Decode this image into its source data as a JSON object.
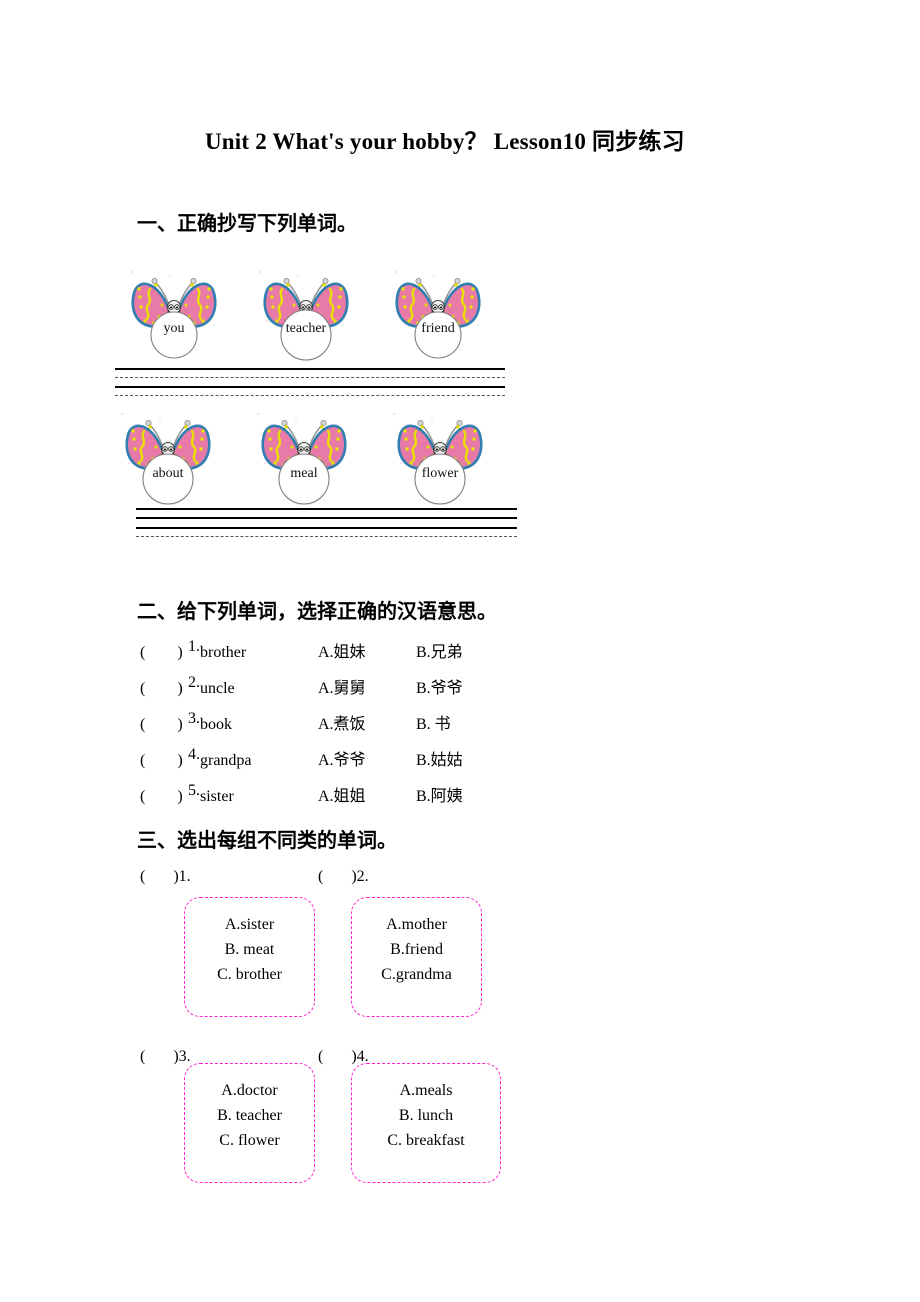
{
  "document": {
    "title": "Unit 2 What's your hobby？ Lesson10  同步练习"
  },
  "sections": [
    {
      "heading": "一、正确抄写下列单词。",
      "type": "copy-words",
      "rows": [
        {
          "words": [
            "you",
            "teacher",
            "friend"
          ]
        },
        {
          "words": [
            "about",
            "meal",
            "flower"
          ]
        }
      ]
    },
    {
      "heading": "二、给下列单词，选择正确的汉语意思。",
      "type": "match-meaning",
      "items": [
        {
          "paren": "(        )",
          "number": "1.",
          "word": "brother",
          "option_a": "A.姐妹",
          "option_b": "B.兄弟"
        },
        {
          "paren": "(        )",
          "number": "2.",
          "word": "uncle",
          "option_a": "A.舅舅",
          "option_b": "B.爷爷"
        },
        {
          "paren": "(        )",
          "number": "3.",
          "word": "book",
          "option_a": "A.煮饭",
          "option_b": "B. 书"
        },
        {
          "paren": "(        )",
          "number": "4.",
          "word": "grandpa",
          "option_a": "A.爷爷",
          "option_b": "B.姑姑"
        },
        {
          "paren": "(        )",
          "number": "5.",
          "word": "sister",
          "option_a": "A.姐姐",
          "option_b": "B.阿姨"
        }
      ]
    },
    {
      "heading": "三、选出每组不同类的单词。",
      "type": "odd-one-out",
      "groups": [
        {
          "label": "(       )1.",
          "options": [
            "A.sister",
            "B. meat",
            "C. brother"
          ]
        },
        {
          "label": "(       )2.",
          "options": [
            "A.mother",
            "B.friend",
            "C.grandma"
          ]
        },
        {
          "label": "(       )3.",
          "options": [
            "A.doctor",
            "B. teacher",
            "C. flower"
          ]
        },
        {
          "label": "(       )4.",
          "options": [
            "A.meals",
            "B. lunch",
            "C. breakfast"
          ]
        }
      ]
    }
  ],
  "colors": {
    "page_background": "#ffffff",
    "text": "#000000",
    "box_border": "#ff22cc",
    "butterfly_wing": "#e87aa8",
    "butterfly_wing_outline": "#2f7fb0",
    "butterfly_spots": "#e8e000",
    "butterfly_body": "#8a5a22",
    "bubble_outline": "#808080",
    "writing_line_solid": "#000000",
    "writing_line_dashed": "#555555"
  },
  "icons": {
    "butterfly": "butterfly-icon",
    "bubble": "speech-bubble-circle-icon"
  }
}
